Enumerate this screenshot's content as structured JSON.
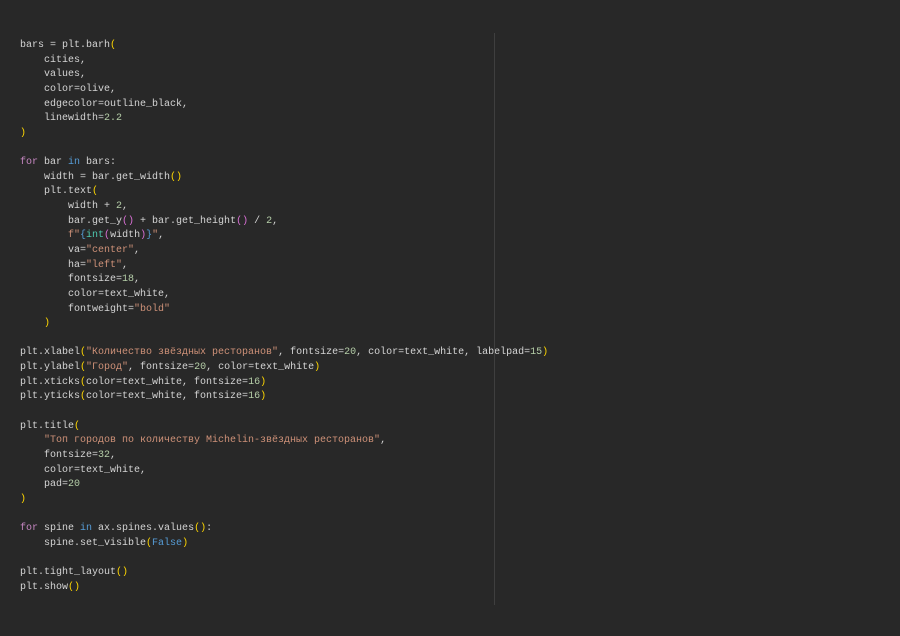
{
  "editor": {
    "lines": [
      [
        [
          "tx",
          "bars = plt.barh"
        ],
        [
          "p1",
          "("
        ]
      ],
      [
        [
          "tx",
          "    cities,"
        ]
      ],
      [
        [
          "tx",
          "    values,"
        ]
      ],
      [
        [
          "tx",
          "    color=olive,"
        ]
      ],
      [
        [
          "tx",
          "    edgecolor=outline_black,"
        ]
      ],
      [
        [
          "tx",
          "    linewidth="
        ],
        [
          "num",
          "2.2"
        ]
      ],
      [
        [
          "p1",
          ")"
        ]
      ],
      [],
      [
        [
          "kw",
          "for"
        ],
        [
          "tx",
          " bar "
        ],
        [
          "bl",
          "in"
        ],
        [
          "tx",
          " bars:"
        ]
      ],
      [
        [
          "tx",
          "    width = bar.get_width"
        ],
        [
          "p1",
          "()"
        ]
      ],
      [
        [
          "tx",
          "    plt.text"
        ],
        [
          "p1",
          "("
        ]
      ],
      [
        [
          "tx",
          "        width + "
        ],
        [
          "num",
          "2"
        ],
        [
          "tx",
          ","
        ]
      ],
      [
        [
          "tx",
          "        bar.get_y"
        ],
        [
          "p2",
          "()"
        ],
        [
          "tx",
          " + bar.get_height"
        ],
        [
          "p2",
          "()"
        ],
        [
          "tx",
          " / "
        ],
        [
          "num",
          "2"
        ],
        [
          "tx",
          ","
        ]
      ],
      [
        [
          "str",
          "        f\""
        ],
        [
          "bl",
          "{"
        ],
        [
          "fn",
          "int"
        ],
        [
          "p2",
          "("
        ],
        [
          "tx",
          "width"
        ],
        [
          "p2",
          ")"
        ],
        [
          "bl",
          "}"
        ],
        [
          "str",
          "\""
        ],
        [
          "tx",
          ","
        ]
      ],
      [
        [
          "tx",
          "        va="
        ],
        [
          "str",
          "\"center\""
        ],
        [
          "tx",
          ","
        ]
      ],
      [
        [
          "tx",
          "        ha="
        ],
        [
          "str",
          "\"left\""
        ],
        [
          "tx",
          ","
        ]
      ],
      [
        [
          "tx",
          "        fontsize="
        ],
        [
          "num",
          "18"
        ],
        [
          "tx",
          ","
        ]
      ],
      [
        [
          "tx",
          "        color=text_white,"
        ]
      ],
      [
        [
          "tx",
          "        fontweight="
        ],
        [
          "str",
          "\"bold\""
        ]
      ],
      [
        [
          "p1",
          "    )"
        ]
      ],
      [],
      [
        [
          "tx",
          "plt.xlabel"
        ],
        [
          "p1",
          "("
        ],
        [
          "str",
          "\"Количество звёздных ресторанов\""
        ],
        [
          "tx",
          ", fontsize="
        ],
        [
          "num",
          "20"
        ],
        [
          "tx",
          ", color=text_white, labelpad="
        ],
        [
          "num",
          "15"
        ],
        [
          "p1",
          ")"
        ]
      ],
      [
        [
          "tx",
          "plt.ylabel"
        ],
        [
          "p1",
          "("
        ],
        [
          "str",
          "\"Город\""
        ],
        [
          "tx",
          ", fontsize="
        ],
        [
          "num",
          "20"
        ],
        [
          "tx",
          ", color=text_white"
        ],
        [
          "p1",
          ")"
        ]
      ],
      [
        [
          "tx",
          "plt.xticks"
        ],
        [
          "p1",
          "("
        ],
        [
          "tx",
          "color=text_white, fontsize="
        ],
        [
          "num",
          "16"
        ],
        [
          "p1",
          ")"
        ]
      ],
      [
        [
          "tx",
          "plt.yticks"
        ],
        [
          "p1",
          "("
        ],
        [
          "tx",
          "color=text_white, fontsize="
        ],
        [
          "num",
          "16"
        ],
        [
          "p1",
          ")"
        ]
      ],
      [],
      [
        [
          "tx",
          "plt.title"
        ],
        [
          "p1",
          "("
        ]
      ],
      [
        [
          "str",
          "    \"Топ городов по количеству Michelin-звёздных ресторанов\""
        ],
        [
          "tx",
          ","
        ]
      ],
      [
        [
          "tx",
          "    fontsize="
        ],
        [
          "num",
          "32"
        ],
        [
          "tx",
          ","
        ]
      ],
      [
        [
          "tx",
          "    color=text_white,"
        ]
      ],
      [
        [
          "tx",
          "    pad="
        ],
        [
          "num",
          "20"
        ]
      ],
      [
        [
          "p1",
          ")"
        ]
      ],
      [],
      [
        [
          "kw",
          "for"
        ],
        [
          "tx",
          " spine "
        ],
        [
          "bl",
          "in"
        ],
        [
          "tx",
          " ax.spines.values"
        ],
        [
          "p1",
          "()"
        ],
        [
          "tx",
          ":"
        ]
      ],
      [
        [
          "tx",
          "    spine.set_visible"
        ],
        [
          "p1",
          "("
        ],
        [
          "bl",
          "False"
        ],
        [
          "p1",
          ")"
        ]
      ],
      [],
      [
        [
          "tx",
          "plt.tight_layout"
        ],
        [
          "p1",
          "()"
        ]
      ],
      [
        [
          "tx",
          "plt.show"
        ],
        [
          "p1",
          "()"
        ]
      ]
    ]
  }
}
